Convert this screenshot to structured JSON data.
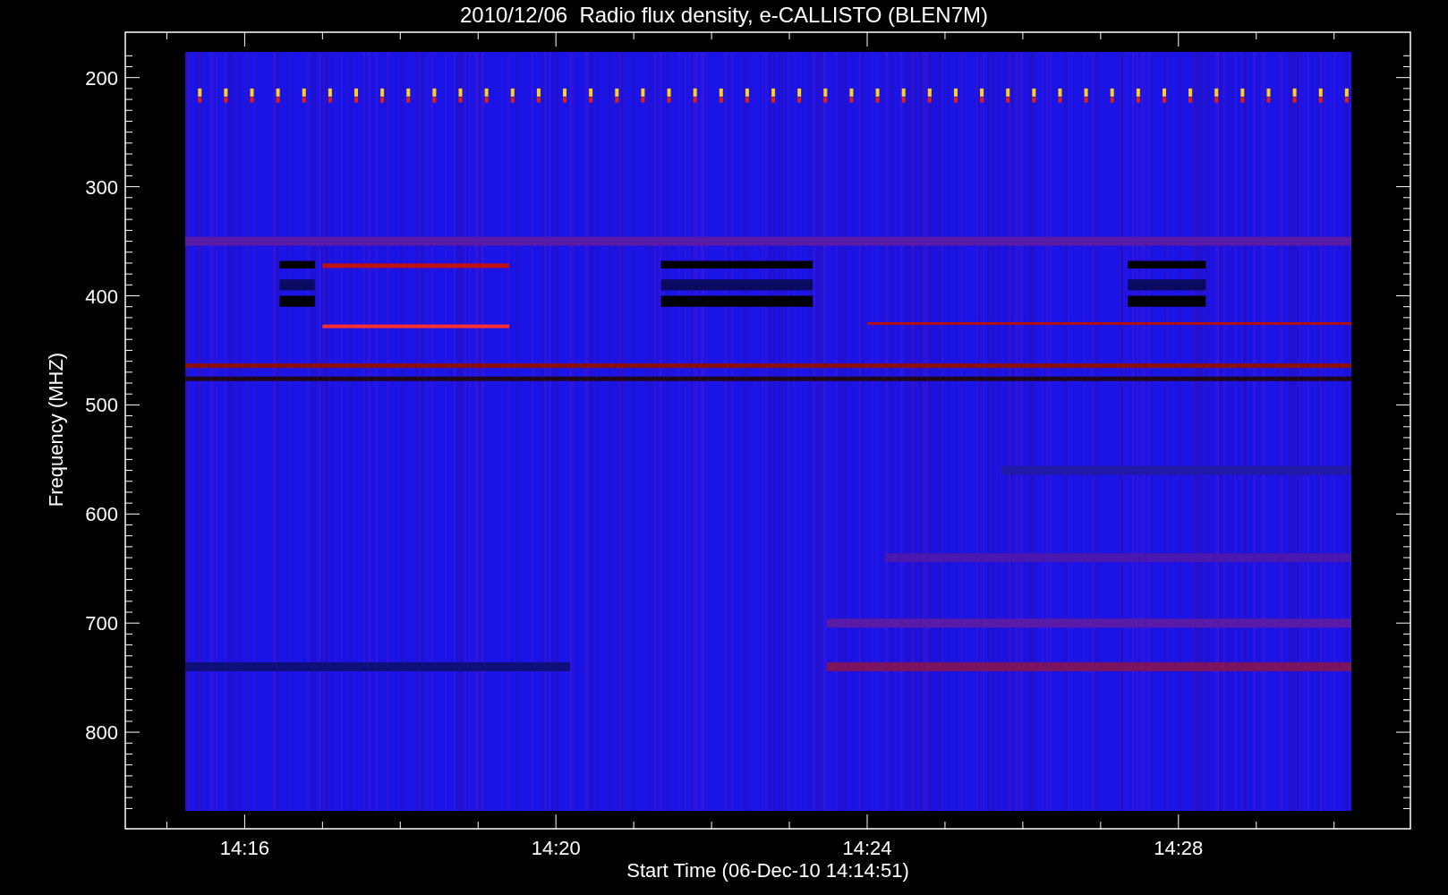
{
  "title": "2010/12/06  Radio flux density, e-CALLISTO (BLEN7M)",
  "y_axis": {
    "label": "Frequency (MHZ)",
    "ticks": [
      "200",
      "300",
      "400",
      "500",
      "600",
      "700",
      "800"
    ]
  },
  "x_axis": {
    "label": "Start Time (06-Dec-10 14:14:51)",
    "ticks": [
      "14:16",
      "14:20",
      "14:24",
      "14:28"
    ]
  }
}
